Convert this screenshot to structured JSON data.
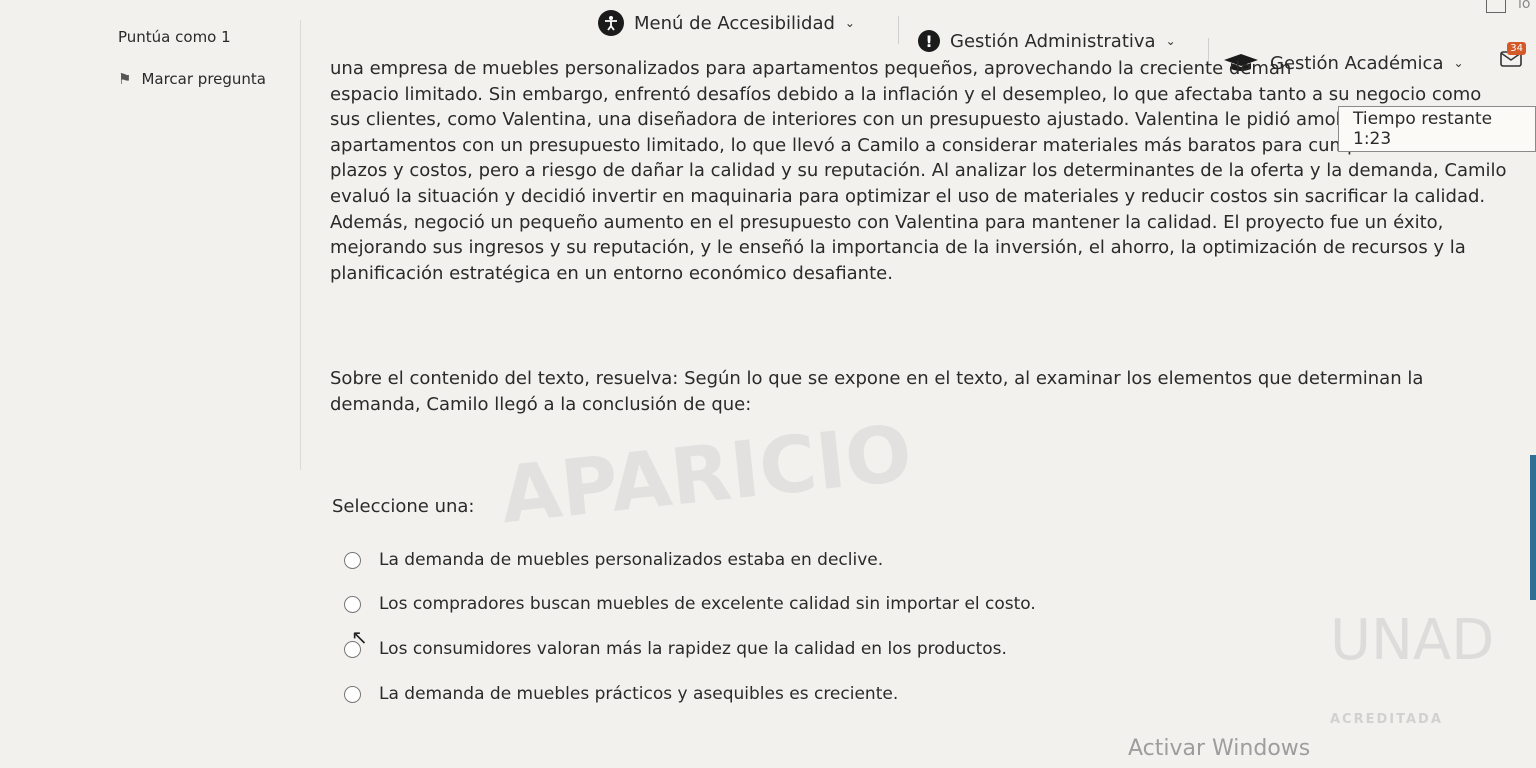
{
  "nav": {
    "accessibility_label": "Menú de Accesibilidad",
    "admin_label": "Gestión Administrativa",
    "academic_label": "Gestión Académica",
    "notification_count": "34",
    "corner_text": "lo"
  },
  "info": {
    "score_label": "Puntúa como 1",
    "flag_label": "Marcar pregunta"
  },
  "timer": {
    "label": "Tiempo restante 1:23"
  },
  "question": {
    "lines": [
      "una empresa de muebles personalizados para apartamentos pequeños, aprovechando la creciente deman",
      "espacio limitado. Sin embargo, enfrentó desafíos debido a la inflación y el desempleo, lo que afectaba tanto a su negocio como",
      "sus clientes, como Valentina, una diseñadora de interiores con un presupuesto ajustado. Valentina le pidió amoblar diez",
      "apartamentos con un presupuesto limitado, lo que llevó a Camilo a considerar materiales más baratos para cumplir con los",
      "plazos y costos, pero a riesgo de dañar la calidad y su reputación. Al analizar los determinantes de la oferta y la demanda, Camilo",
      "evaluó la situación y decidió invertir en maquinaria para optimizar el uso de materiales y reducir costos sin sacrificar la calidad.",
      "Además, negoció un pequeño aumento en el presupuesto con Valentina para mantener la calidad. El proyecto fue un éxito,",
      "mejorando sus ingresos y su reputación, y le enseñó la importancia de la inversión, el ahorro, la optimización de recursos y la",
      "planificación estratégica en un entorno económico desafiante."
    ],
    "prompt": "Sobre el contenido del texto, resuelva: Según lo que se expone en el texto, al examinar los elementos que determinan la demanda, Camilo llegó a la conclusión de que:"
  },
  "answers": {
    "select_label": "Seleccione una:",
    "options": [
      "La demanda de muebles personalizados estaba en declive.",
      "Los compradores buscan muebles de excelente calidad sin importar el costo.",
      "Los consumidores valoran más la rapidez que la calidad en los productos.",
      "La demanda de muebles prácticos y asequibles es creciente."
    ]
  },
  "watermarks": {
    "name": "APARICIO",
    "logo": "UNAD",
    "accreditation": "ACREDITADA"
  },
  "system": {
    "activate_windows": "Activar Windows"
  },
  "icons": [
    "accessibility-icon",
    "alert-icon",
    "graduation-cap-icon",
    "message-icon",
    "flag-icon",
    "cursor-icon"
  ]
}
